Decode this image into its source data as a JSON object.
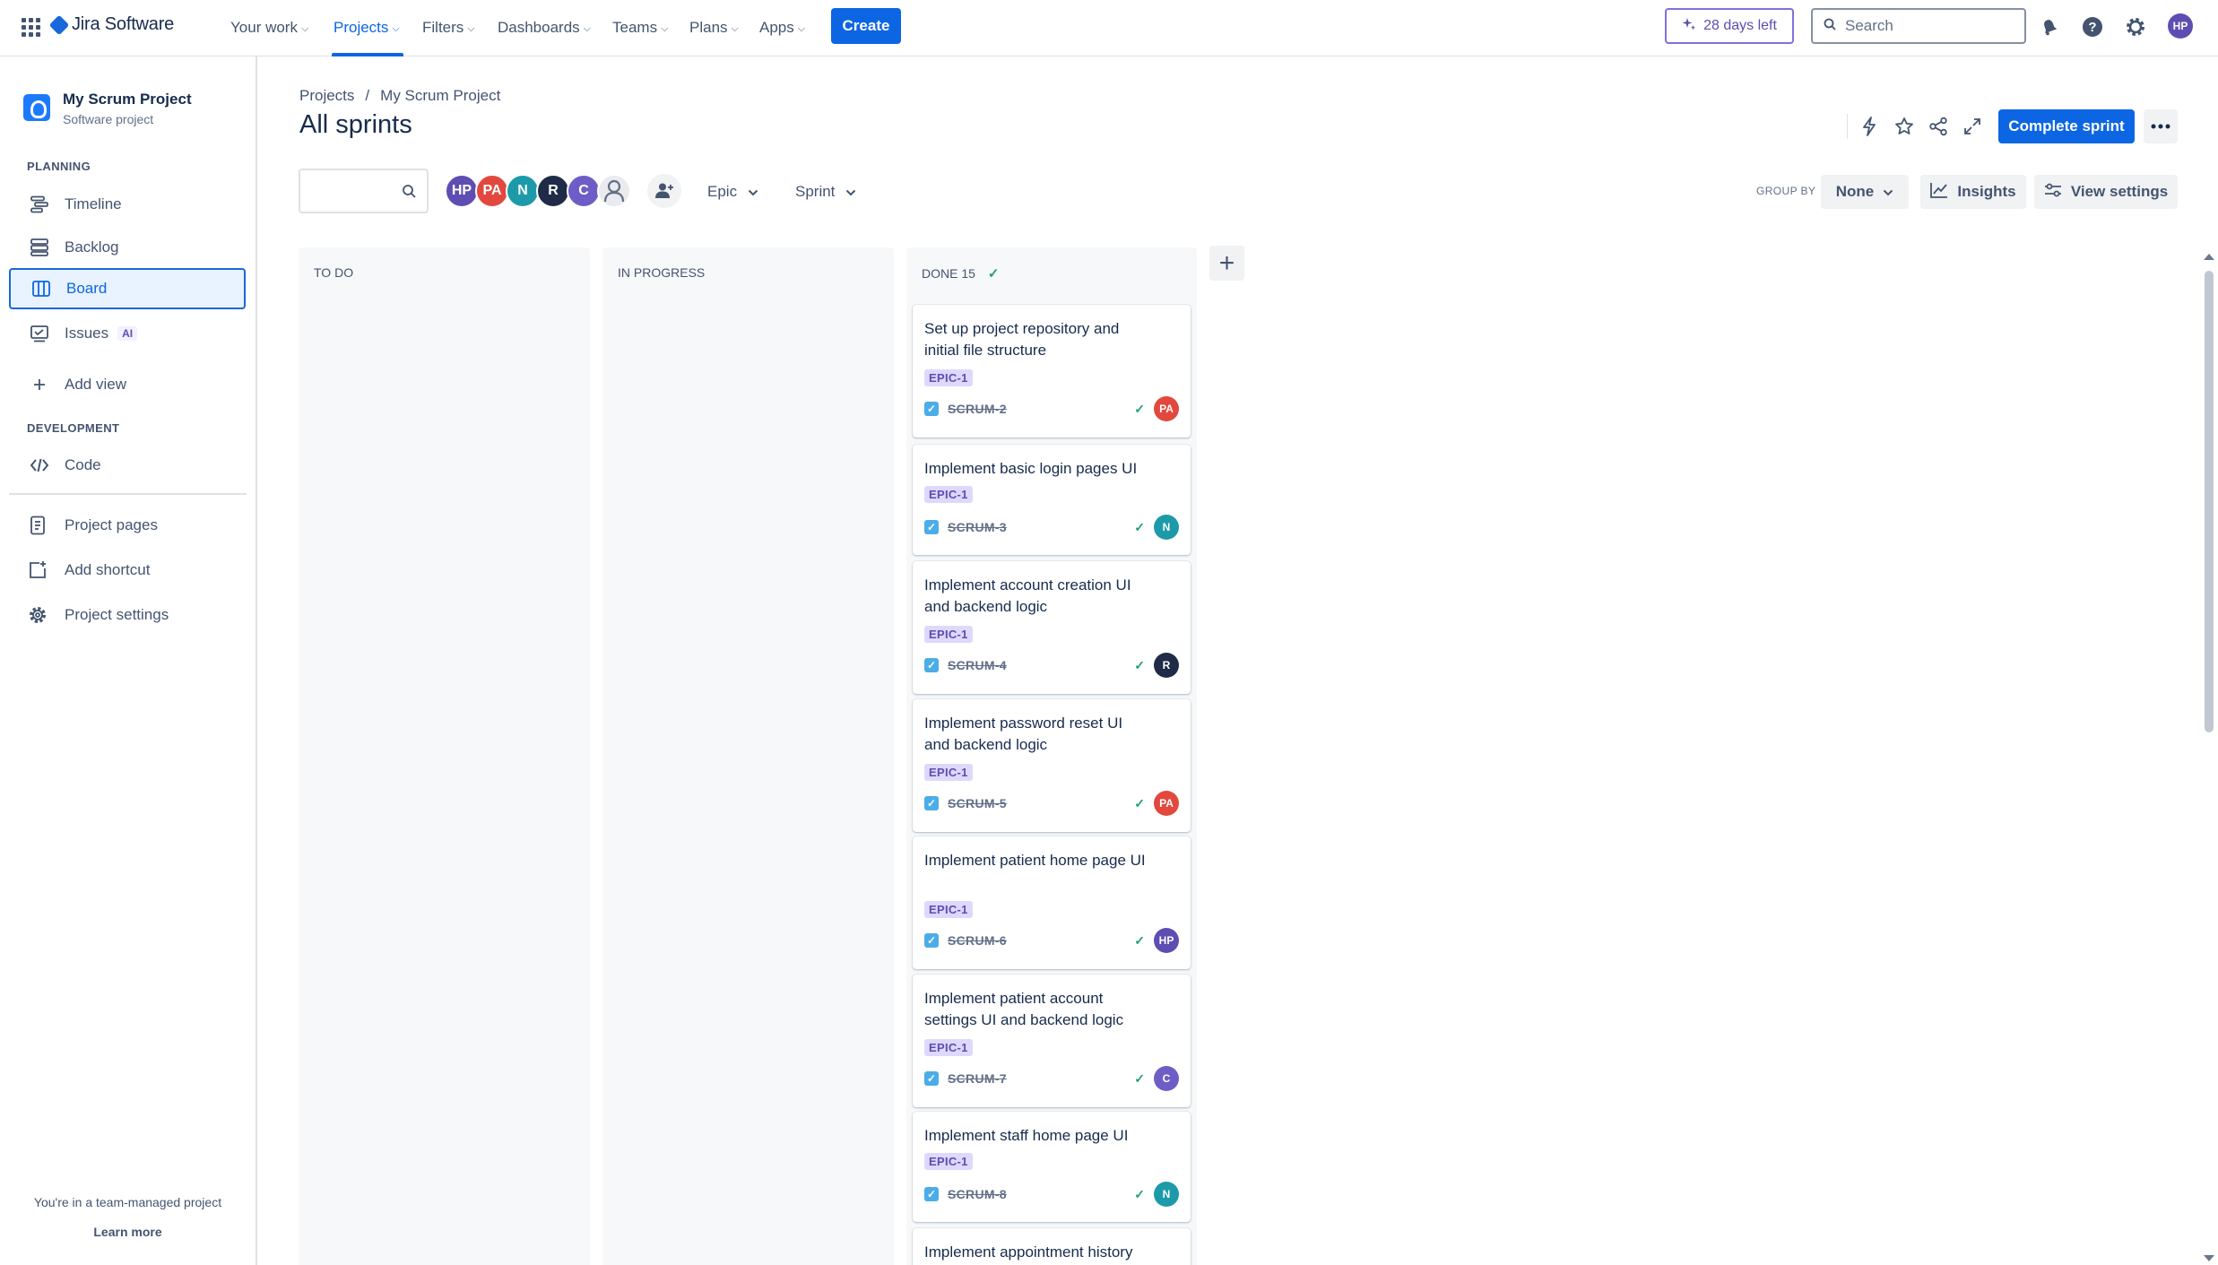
{
  "topnav": {
    "brand": "Jira Software",
    "items": [
      "Your work",
      "Projects",
      "Filters",
      "Dashboards",
      "Teams",
      "Plans",
      "Apps"
    ],
    "create_label": "Create",
    "trial_label": "28 days left",
    "search_placeholder": "Search",
    "user_initials": "HP"
  },
  "sidebar": {
    "project_name": "My Scrum Project",
    "project_type": "Software project",
    "planning_label": "PLANNING",
    "planning_items": [
      "Timeline",
      "Backlog",
      "Board",
      "Issues"
    ],
    "issues_badge": "AI",
    "add_view_label": "Add view",
    "development_label": "DEVELOPMENT",
    "code_label": "Code",
    "bottom_items": [
      "Project pages",
      "Add shortcut",
      "Project settings"
    ],
    "footer_text": "You're in a team-managed project",
    "learn_more": "Learn more"
  },
  "main": {
    "breadcrumb": [
      "Projects",
      "/",
      "My Scrum Project"
    ],
    "title": "All sprints",
    "complete_sprint": "Complete sprint",
    "filter_avatars": [
      {
        "initials": "HP",
        "color": "#5e4db2"
      },
      {
        "initials": "PA",
        "color": "#e2483d"
      },
      {
        "initials": "N",
        "color": "#1d9aaa"
      },
      {
        "initials": "R",
        "color": "#1f2b47"
      },
      {
        "initials": "C",
        "color": "#6e5dc6"
      }
    ],
    "epic_filter": "Epic",
    "sprint_filter": "Sprint",
    "group_by_label": "GROUP BY",
    "group_by_value": "None",
    "insights_label": "Insights",
    "view_settings_label": "View settings"
  },
  "columns": [
    {
      "title": "TO DO"
    },
    {
      "title": "IN PROGRESS"
    },
    {
      "title": "DONE 15"
    }
  ],
  "cards": [
    {
      "title": "Set up project repository and initial file structure",
      "epic": "EPIC-1",
      "key": "SCRUM-2",
      "assignee": "PA",
      "color": "#e2483d"
    },
    {
      "title": "Implement basic login pages UI",
      "epic": "EPIC-1",
      "key": "SCRUM-3",
      "assignee": "N",
      "color": "#1d9aaa"
    },
    {
      "title": "Implement account creation UI and backend logic",
      "epic": "EPIC-1",
      "key": "SCRUM-4",
      "assignee": "R",
      "color": "#1f2b47"
    },
    {
      "title": "Implement password reset UI and backend logic",
      "epic": "EPIC-1",
      "key": "SCRUM-5",
      "assignee": "PA",
      "color": "#e2483d"
    },
    {
      "title": "Implement patient home page UI",
      "epic": "EPIC-1",
      "key": "SCRUM-6",
      "assignee": "HP",
      "color": "#5e4db2"
    },
    {
      "title": "Implement patient account settings UI and backend logic",
      "epic": "EPIC-1",
      "key": "SCRUM-7",
      "assignee": "C",
      "color": "#6e5dc6"
    },
    {
      "title": "Implement staff home page UI",
      "epic": "EPIC-1",
      "key": "SCRUM-8",
      "assignee": "N",
      "color": "#1d9aaa"
    },
    {
      "title": "Implement appointment history",
      "epic": "",
      "key": "",
      "assignee": "",
      "color": ""
    }
  ]
}
